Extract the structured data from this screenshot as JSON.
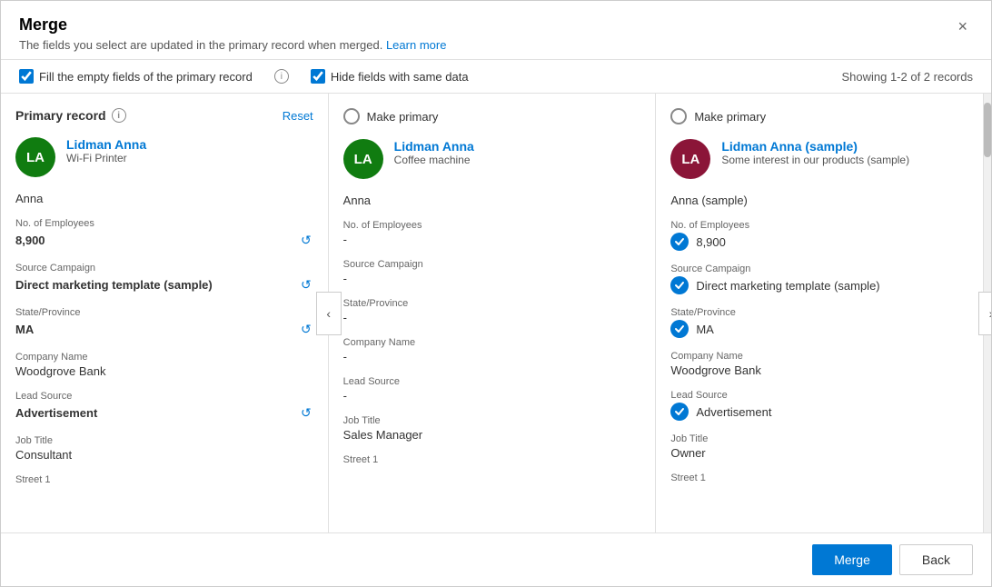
{
  "dialog": {
    "title": "Merge",
    "subtitle": "The fields you select are updated in the primary record when merged.",
    "learn_more": "Learn more",
    "close_label": "×"
  },
  "options": {
    "fill_empty": "Fill the empty fields of the primary record",
    "hide_same": "Hide fields with same data",
    "showing": "Showing 1-2 of 2 records"
  },
  "columns": [
    {
      "id": "primary",
      "header_label": "Primary record",
      "show_radio": false,
      "show_reset": true,
      "reset_label": "Reset",
      "avatar_initials": "LA",
      "avatar_color": "green",
      "record_name": "Lidman Anna",
      "record_desc": "Wi-Fi Printer",
      "first_name": "Anna",
      "fields": [
        {
          "label": "No. of Employees",
          "value": "8,900",
          "bold": true,
          "show_undo": true,
          "show_check": false
        },
        {
          "label": "Source Campaign",
          "value": "Direct marketing template (sample)",
          "bold": true,
          "show_undo": true,
          "show_check": false
        },
        {
          "label": "State/Province",
          "value": "MA",
          "bold": true,
          "show_undo": true,
          "show_check": false
        },
        {
          "label": "Company Name",
          "value": "Woodgrove Bank",
          "bold": false,
          "show_undo": false,
          "show_check": false
        },
        {
          "label": "Lead Source",
          "value": "Advertisement",
          "bold": true,
          "show_undo": true,
          "show_check": false
        },
        {
          "label": "Job Title",
          "value": "Consultant",
          "bold": false,
          "show_undo": false,
          "show_check": false
        },
        {
          "label": "Street 1",
          "value": "",
          "bold": false,
          "show_undo": false,
          "show_check": false
        }
      ]
    },
    {
      "id": "second",
      "header_label": "Make primary",
      "show_radio": true,
      "show_reset": false,
      "reset_label": "",
      "avatar_initials": "LA",
      "avatar_color": "green",
      "record_name": "Lidman Anna",
      "record_desc": "Coffee machine",
      "first_name": "Anna",
      "fields": [
        {
          "label": "No. of Employees",
          "value": "-",
          "bold": false,
          "show_undo": false,
          "show_check": false
        },
        {
          "label": "Source Campaign",
          "value": "-",
          "bold": false,
          "show_undo": false,
          "show_check": false
        },
        {
          "label": "State/Province",
          "value": "-",
          "bold": false,
          "show_undo": false,
          "show_check": false
        },
        {
          "label": "Company Name",
          "value": "-",
          "bold": false,
          "show_undo": false,
          "show_check": false
        },
        {
          "label": "Lead Source",
          "value": "-",
          "bold": false,
          "show_undo": false,
          "show_check": false
        },
        {
          "label": "Job Title",
          "value": "Sales Manager",
          "bold": false,
          "show_undo": false,
          "show_check": false
        },
        {
          "label": "Street 1",
          "value": "",
          "bold": false,
          "show_undo": false,
          "show_check": false
        }
      ]
    },
    {
      "id": "third",
      "header_label": "Make primary",
      "show_radio": true,
      "show_reset": false,
      "reset_label": "",
      "avatar_initials": "LA",
      "avatar_color": "dark-red",
      "record_name": "Lidman Anna (sample)",
      "record_desc": "Some interest in our products (sample)",
      "first_name": "Anna (sample)",
      "fields": [
        {
          "label": "No. of Employees",
          "value": "8,900",
          "bold": false,
          "show_undo": false,
          "show_check": true
        },
        {
          "label": "Source Campaign",
          "value": "Direct marketing template (sample)",
          "bold": false,
          "show_undo": false,
          "show_check": true
        },
        {
          "label": "State/Province",
          "value": "MA",
          "bold": false,
          "show_undo": false,
          "show_check": true
        },
        {
          "label": "Company Name",
          "value": "Woodgrove Bank",
          "bold": false,
          "show_undo": false,
          "show_check": false
        },
        {
          "label": "Lead Source",
          "value": "Advertisement",
          "bold": false,
          "show_undo": false,
          "show_check": true
        },
        {
          "label": "Job Title",
          "value": "Owner",
          "bold": false,
          "show_undo": false,
          "show_check": false
        },
        {
          "label": "Street 1",
          "value": "",
          "bold": false,
          "show_undo": false,
          "show_check": false
        }
      ]
    }
  ],
  "footer": {
    "merge_label": "Merge",
    "back_label": "Back"
  }
}
